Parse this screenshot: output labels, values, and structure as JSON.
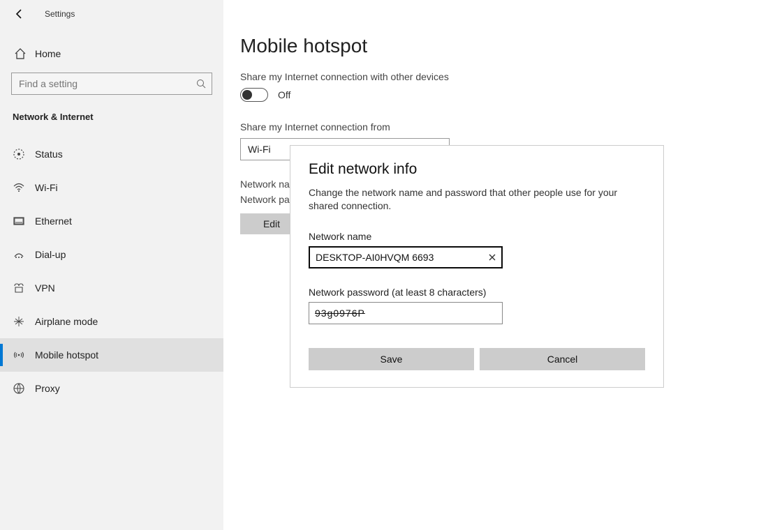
{
  "header": {
    "app_title": "Settings"
  },
  "sidebar": {
    "home_label": "Home",
    "search_placeholder": "Find a setting",
    "group_label": "Network & Internet",
    "items": [
      {
        "label": "Status",
        "icon": "status-icon",
        "selected": false
      },
      {
        "label": "Wi-Fi",
        "icon": "wifi-icon",
        "selected": false
      },
      {
        "label": "Ethernet",
        "icon": "ethernet-icon",
        "selected": false
      },
      {
        "label": "Dial-up",
        "icon": "dialup-icon",
        "selected": false
      },
      {
        "label": "VPN",
        "icon": "vpn-icon",
        "selected": false
      },
      {
        "label": "Airplane mode",
        "icon": "airplane-icon",
        "selected": false
      },
      {
        "label": "Mobile hotspot",
        "icon": "hotspot-icon",
        "selected": true
      },
      {
        "label": "Proxy",
        "icon": "globe-icon",
        "selected": false
      }
    ]
  },
  "main": {
    "page_title": "Mobile hotspot",
    "share_label": "Share my Internet connection with other devices",
    "toggle_state": "Off",
    "share_from_label": "Share my Internet connection from",
    "share_from_value": "Wi-Fi",
    "network_name_label_trunc": "Network na",
    "network_password_label_trunc": "Network pa",
    "edit_button": "Edit"
  },
  "dialog": {
    "title": "Edit network info",
    "description": "Change the network name and password that other people use for your shared connection.",
    "name_label": "Network name",
    "name_value": "DESKTOP-AI0HVQM 6693",
    "password_label": "Network password (at least 8 characters)",
    "password_value": "93g0976P",
    "save_label": "Save",
    "cancel_label": "Cancel"
  }
}
